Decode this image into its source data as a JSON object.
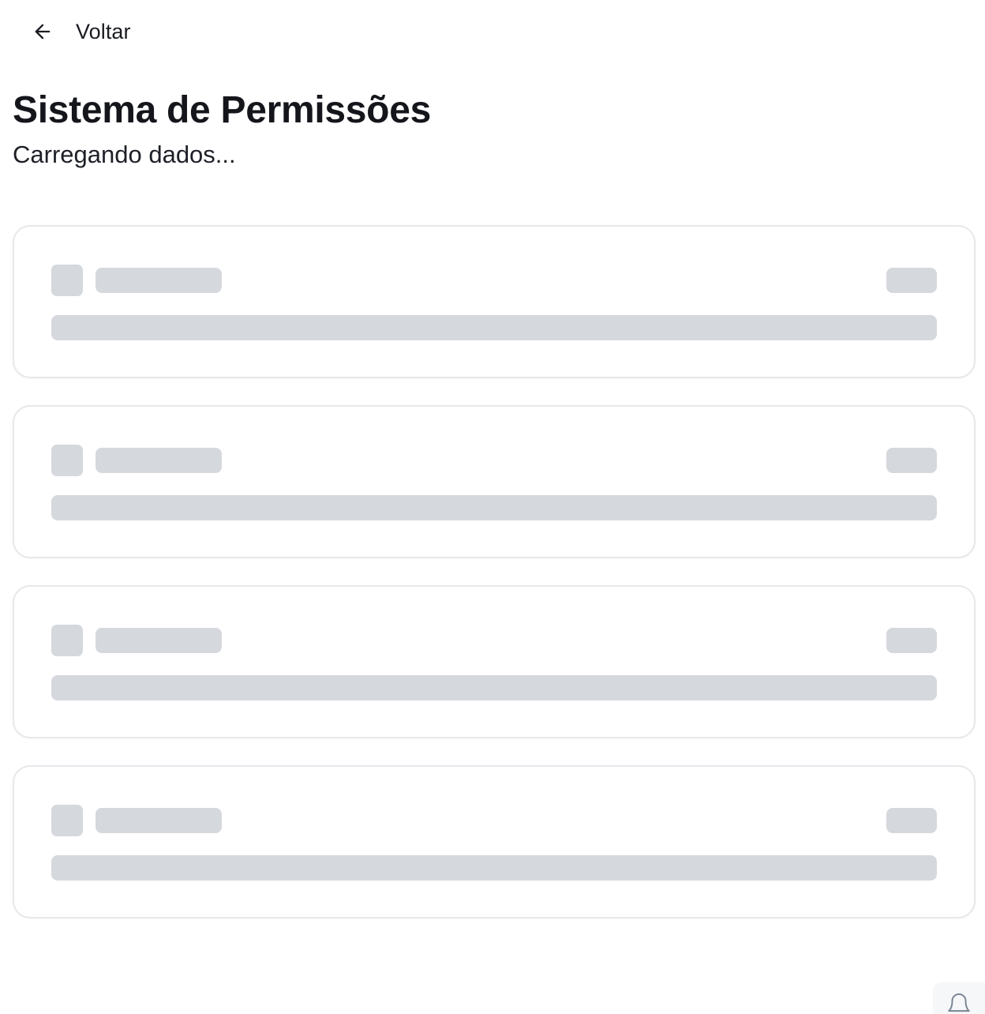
{
  "header": {
    "back_label": "Voltar",
    "back_icon": "arrow-left-icon"
  },
  "main": {
    "title": "Sistema de Permissões",
    "subtitle": "Carregando dados...",
    "skeleton_cards": 4
  },
  "floating": {
    "notification_icon": "bell-icon"
  },
  "colors": {
    "skeleton": "#d5d8dc",
    "card_border": "#e7e8eb",
    "text": "#111318"
  }
}
